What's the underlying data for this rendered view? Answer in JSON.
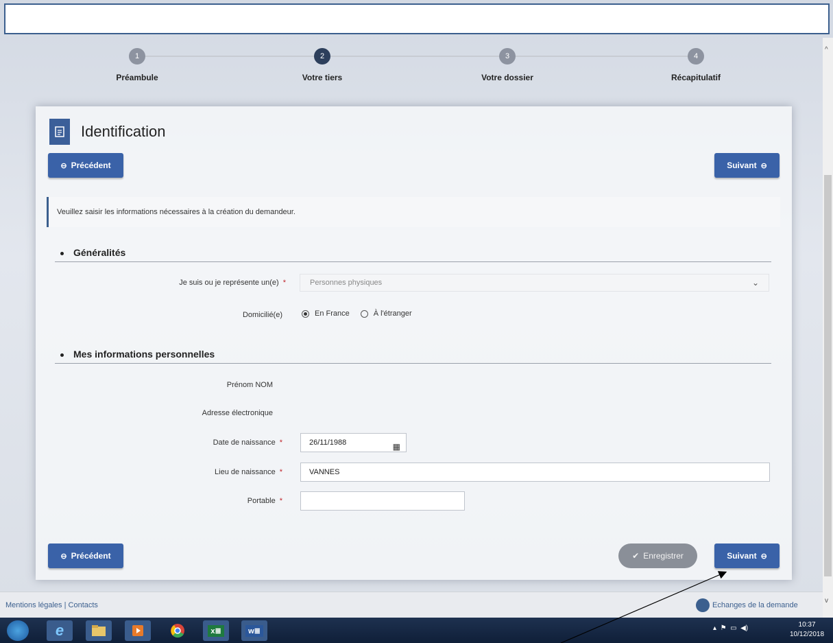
{
  "stepper": {
    "steps": [
      {
        "num": "1",
        "label": "Préambule"
      },
      {
        "num": "2",
        "label": "Votre tiers"
      },
      {
        "num": "3",
        "label": "Votre dossier"
      },
      {
        "num": "4",
        "label": "Récapitulatif"
      }
    ],
    "active_step": "2"
  },
  "card": {
    "title": "Identification",
    "prev_label": "Précédent",
    "next_label": "Suivant",
    "save_label": "Enregistrer",
    "info_text": "Veuillez saisir les informations nécessaires à la création du demandeur."
  },
  "generalites": {
    "title": "Généralités",
    "type_label": "Je suis ou je représente un(e)",
    "type_value": "Personnes physiques",
    "domicile_label": "Domicilié(e)",
    "domicile_options": [
      "En France",
      "À l'étranger"
    ],
    "domicile_selected": "En France"
  },
  "personal": {
    "title": "Mes informations personnelles",
    "name_label": "Prénom NOM",
    "email_label": "Adresse électronique",
    "birthdate_label": "Date de naissance",
    "birthdate_value": "26/11/1988",
    "birthplace_label": "Lieu de naissance",
    "birthplace_value": "VANNES",
    "phone_label": "Portable",
    "required_mark": "*"
  },
  "footer": {
    "links": "Mentions légales | Contacts",
    "exchanges": "Echanges de la demande"
  },
  "taskbar": {
    "time": "10:37",
    "date": "10/12/2018"
  },
  "colors": {
    "primary": "#3a62a8",
    "step_active": "#2d3f5c",
    "required": "#c0262c"
  }
}
